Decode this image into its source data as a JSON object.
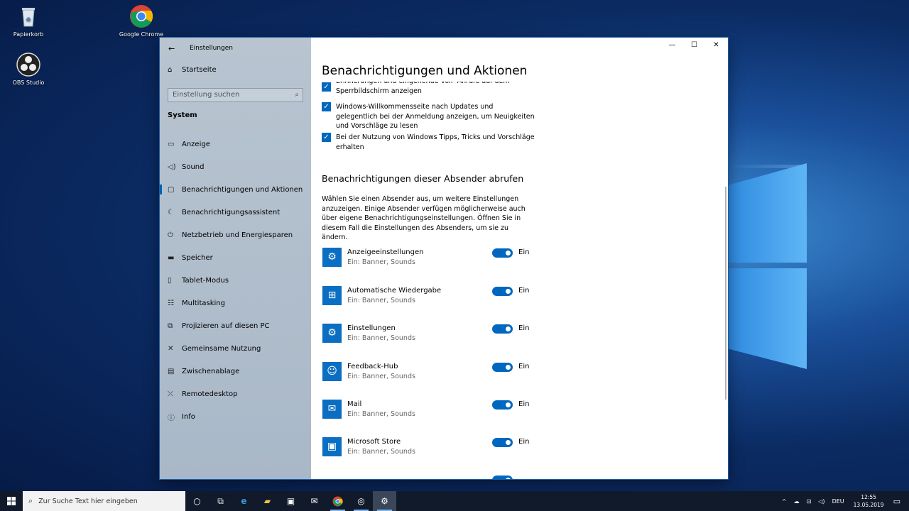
{
  "desktop": {
    "icons": [
      {
        "label": "Papierkorb"
      },
      {
        "label": "Google Chrome"
      },
      {
        "label": "OBS Studio"
      }
    ]
  },
  "window": {
    "title": "Einstellungen",
    "sidebar": {
      "home_label": "Startseite",
      "search_placeholder": "Einstellung suchen",
      "section": "System",
      "items": [
        {
          "label": "Anzeige",
          "icon": "monitor-icon"
        },
        {
          "label": "Sound",
          "icon": "speaker-icon"
        },
        {
          "label": "Benachrichtigungen und Aktionen",
          "icon": "message-icon",
          "active": true
        },
        {
          "label": "Benachrichtigungsassistent",
          "icon": "moon-icon"
        },
        {
          "label": "Netzbetrieb und Energiesparen",
          "icon": "power-icon"
        },
        {
          "label": "Speicher",
          "icon": "drive-icon"
        },
        {
          "label": "Tablet-Modus",
          "icon": "tablet-icon"
        },
        {
          "label": "Multitasking",
          "icon": "multitask-icon"
        },
        {
          "label": "Projizieren auf diesen PC",
          "icon": "project-icon"
        },
        {
          "label": "Gemeinsame Nutzung",
          "icon": "share-icon"
        },
        {
          "label": "Zwischenablage",
          "icon": "clipboard-icon"
        },
        {
          "label": "Remotedesktop",
          "icon": "remote-icon"
        },
        {
          "label": "Info",
          "icon": "info-icon"
        }
      ]
    },
    "main": {
      "title": "Benachrichtigungen und Aktionen",
      "checkboxes": [
        {
          "text": "Erinnerungen und eingehende VoIP-Anrufe auf dem Sperrbildschirm anzeigen",
          "checked": true
        },
        {
          "text": "Windows-Willkommensseite nach Updates und gelegentlich bei der Anmeldung anzeigen, um Neuigkeiten und Vorschläge zu lesen",
          "checked": true
        },
        {
          "text": "Bei der Nutzung von Windows Tipps, Tricks und Vorschläge erhalten",
          "checked": true
        }
      ],
      "senders_title": "Benachrichtigungen dieser Absender abrufen",
      "senders_desc": "Wählen Sie einen Absender aus, um weitere Einstellungen anzuzeigen. Einige Absender verfügen möglicherweise auch über eigene Benachrichtigungseinstellungen. Öffnen Sie in diesem Fall die Einstellungen des Absenders, um sie zu ändern.",
      "apps": [
        {
          "name": "Anzeigeeinstellungen",
          "sub": "Ein: Banner, Sounds",
          "toggle": "Ein",
          "icon": "gear-icon"
        },
        {
          "name": "Automatische Wiedergabe",
          "sub": "Ein: Banner, Sounds",
          "toggle": "Ein",
          "icon": "autoplay-icon"
        },
        {
          "name": "Einstellungen",
          "sub": "Ein: Banner, Sounds",
          "toggle": "Ein",
          "icon": "gear-icon"
        },
        {
          "name": "Feedback-Hub",
          "sub": "Ein: Banner, Sounds",
          "toggle": "Ein",
          "icon": "feedback-icon"
        },
        {
          "name": "Mail",
          "sub": "Ein: Banner, Sounds",
          "toggle": "Ein",
          "icon": "mail-icon"
        },
        {
          "name": "Microsoft Store",
          "sub": "Ein: Banner, Sounds",
          "toggle": "Ein",
          "icon": "store-icon"
        }
      ]
    }
  },
  "taskbar": {
    "search_placeholder": "Zur Suche Text hier eingeben",
    "language": "DEU",
    "time": "12:55",
    "date": "13.05.2019"
  },
  "colors": {
    "accent": "#0067c0",
    "sidebar_bg": "#aebccb",
    "taskbar_bg": "#101a2a"
  }
}
